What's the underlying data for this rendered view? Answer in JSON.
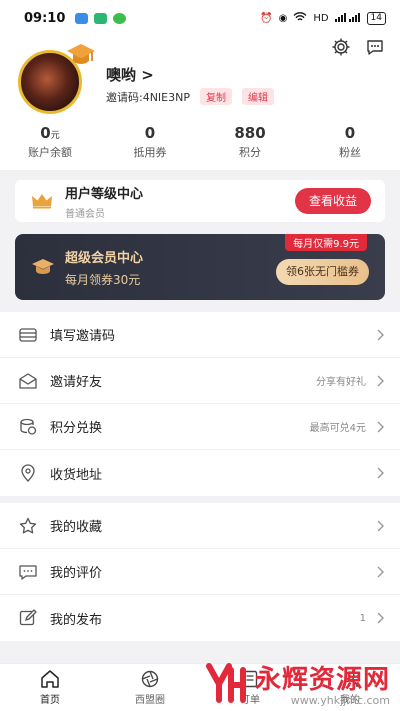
{
  "status": {
    "time": "09:10",
    "battery": "14",
    "network": "HD"
  },
  "profile": {
    "name": "噢哟 >",
    "invite_code": "邀请码:4NIE3NP",
    "copy_label": "复制",
    "edit_label": "编辑"
  },
  "stats": [
    {
      "value": "0",
      "unit": "元",
      "label": "账户余额"
    },
    {
      "value": "0",
      "unit": "",
      "label": "抵用券"
    },
    {
      "value": "880",
      "unit": "",
      "label": "积分"
    },
    {
      "value": "0",
      "unit": "",
      "label": "粉丝"
    }
  ],
  "level": {
    "title": "用户等级中心",
    "subtitle": "普通会员",
    "button": "查看收益"
  },
  "vip": {
    "title": "超级会员中心",
    "subtitle": "每月领券30元",
    "badge": "每月仅需9.9元",
    "button": "领6张无门槛券"
  },
  "menu_group1": [
    {
      "icon": "card-icon",
      "label": "填写邀请码",
      "extra": ""
    },
    {
      "icon": "envelope-icon",
      "label": "邀请好友",
      "extra": "分享有好礼"
    },
    {
      "icon": "coins-icon",
      "label": "积分兑换",
      "extra": "最高可兑4元"
    },
    {
      "icon": "location-icon",
      "label": "收货地址",
      "extra": ""
    }
  ],
  "menu_group2": [
    {
      "icon": "star-icon",
      "label": "我的收藏",
      "extra": ""
    },
    {
      "icon": "comment-icon",
      "label": "我的评价",
      "extra": ""
    },
    {
      "icon": "edit-icon",
      "label": "我的发布",
      "extra": "1"
    }
  ],
  "tabs": [
    {
      "label": "首页",
      "icon": "home-icon"
    },
    {
      "label": "西盟圈",
      "icon": "aperture-icon"
    },
    {
      "label": "订单",
      "icon": "order-icon"
    },
    {
      "label": "我的",
      "icon": "user-icon"
    }
  ],
  "watermark": {
    "text": "永辉资源网",
    "url": "www.yhkjjmc.com"
  },
  "colors": {
    "accent": "#e23447",
    "vip_gold": "#f2d3a5",
    "vip_bg": "#2c2f3c"
  }
}
